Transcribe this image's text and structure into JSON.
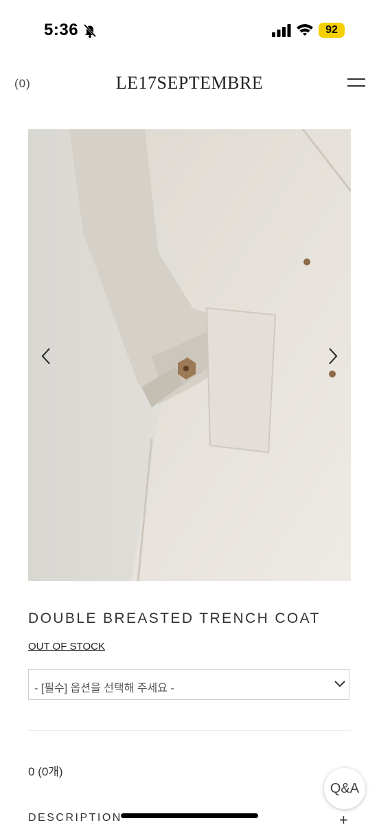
{
  "status_bar": {
    "time": "5:36",
    "battery": "92"
  },
  "header": {
    "cart_count": "(0)",
    "brand": "LE17SEPTEMBRE"
  },
  "product": {
    "title": "DOUBLE BREASTED TRENCH COAT",
    "stock_status": "OUT OF STOCK",
    "option_placeholder": "- [필수] 옵션을 선택해 주세요 -",
    "total": "0 (0개)",
    "description_label": "DESCRIPTION",
    "description_toggle": "+"
  },
  "qa_button": {
    "label": "Q&A"
  },
  "icons": [
    "bell-slash-icon",
    "signal-icon",
    "wifi-icon",
    "menu-icon",
    "chevron-left-icon",
    "chevron-right-icon",
    "chevron-down-icon"
  ]
}
